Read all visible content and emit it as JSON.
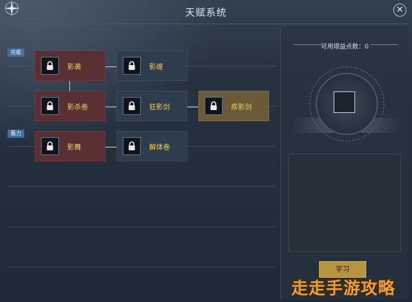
{
  "window": {
    "title": "天赋系统"
  },
  "categories": {
    "charge": "充能",
    "store": "蓄力"
  },
  "talents": {
    "row1": {
      "a": "影袭",
      "b": "影缠"
    },
    "row2": {
      "a": "影杀卷",
      "b": "狂影剑",
      "c": "疾影剑"
    },
    "row3": {
      "a": "影舞",
      "b": "解体卷"
    }
  },
  "side": {
    "bonus_label": "可用增益点数：",
    "bonus_value": "0",
    "learn_button": "学习"
  },
  "watermark": "走走手游攻略",
  "colors": {
    "label_gold": "#f2cf5a",
    "node_red": "#5a2f33",
    "node_blue": "#2e3d4d",
    "node_gold": "#6a5a38",
    "accent_button": "#b6953e"
  },
  "icons": [
    "star-ornament-icon",
    "close-icon",
    "lock-icon"
  ]
}
